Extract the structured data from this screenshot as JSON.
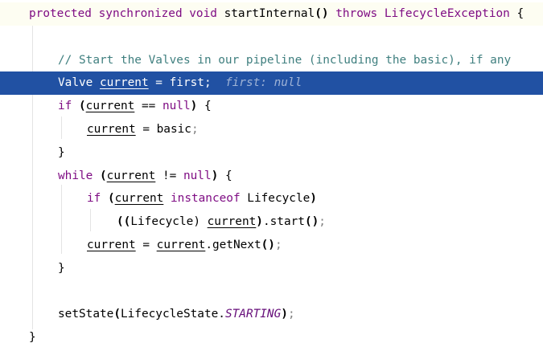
{
  "editor": {
    "lines": [
      {
        "tokens": [
          {
            "text": "protected synchronized void ",
            "role": "kw"
          },
          {
            "text": "startInternal",
            "role": "plain"
          },
          {
            "text": "()",
            "role": "paren"
          },
          {
            "text": " throws ",
            "role": "kw"
          },
          {
            "text": "LifecycleException",
            "role": "ty"
          },
          {
            "text": " {",
            "role": "plain"
          }
        ]
      },
      {
        "tokens": []
      },
      {
        "tokens": [
          {
            "text": "// Start the Valves in our pipeline (including the basic), if any",
            "role": "cm"
          }
        ]
      },
      {
        "tokens": [
          {
            "text": "Valve ",
            "role": "plain"
          },
          {
            "text": "current",
            "role": "var"
          },
          {
            "text": " = first;  ",
            "role": "plain"
          },
          {
            "text": "first: null",
            "role": "hint"
          }
        ]
      },
      {
        "tokens": [
          {
            "text": "if ",
            "role": "kw"
          },
          {
            "text": "(",
            "role": "paren"
          },
          {
            "text": "current",
            "role": "var"
          },
          {
            "text": " == ",
            "role": "plain"
          },
          {
            "text": "null",
            "role": "kw"
          },
          {
            "text": ")",
            "role": "paren"
          },
          {
            "text": " {",
            "role": "plain"
          }
        ]
      },
      {
        "tokens": [
          {
            "text": "current",
            "role": "var"
          },
          {
            "text": " = basic",
            "role": "plain"
          },
          {
            "text": ";",
            "role": "punct"
          }
        ]
      },
      {
        "tokens": [
          {
            "text": "}",
            "role": "plain"
          }
        ]
      },
      {
        "tokens": [
          {
            "text": "while ",
            "role": "kw"
          },
          {
            "text": "(",
            "role": "paren"
          },
          {
            "text": "current",
            "role": "var"
          },
          {
            "text": " != ",
            "role": "plain"
          },
          {
            "text": "null",
            "role": "kw"
          },
          {
            "text": ")",
            "role": "paren"
          },
          {
            "text": " {",
            "role": "plain"
          }
        ]
      },
      {
        "tokens": [
          {
            "text": "if ",
            "role": "kw"
          },
          {
            "text": "(",
            "role": "paren"
          },
          {
            "text": "current",
            "role": "var"
          },
          {
            "text": " instanceof ",
            "role": "kw"
          },
          {
            "text": "Lifecycle",
            "role": "plain"
          },
          {
            "text": ")",
            "role": "paren"
          }
        ]
      },
      {
        "tokens": [
          {
            "text": "((",
            "role": "paren"
          },
          {
            "text": "Lifecycle",
            "role": "plain"
          },
          {
            "text": ") ",
            "role": "plain"
          },
          {
            "text": "current",
            "role": "var"
          },
          {
            "text": ")",
            "role": "paren"
          },
          {
            "text": ".start",
            "role": "plain"
          },
          {
            "text": "()",
            "role": "paren"
          },
          {
            "text": ";",
            "role": "punct"
          }
        ]
      },
      {
        "tokens": [
          {
            "text": "current",
            "role": "var"
          },
          {
            "text": " = ",
            "role": "plain"
          },
          {
            "text": "current",
            "role": "var"
          },
          {
            "text": ".getNext",
            "role": "plain"
          },
          {
            "text": "()",
            "role": "paren"
          },
          {
            "text": ";",
            "role": "punct"
          }
        ]
      },
      {
        "tokens": [
          {
            "text": "}",
            "role": "plain"
          }
        ]
      },
      {
        "tokens": []
      },
      {
        "tokens": [
          {
            "text": "setState",
            "role": "plain"
          },
          {
            "text": "(",
            "role": "paren"
          },
          {
            "text": "LifecycleState.",
            "role": "plain"
          },
          {
            "text": "STARTING",
            "role": "const"
          },
          {
            "text": ")",
            "role": "paren"
          },
          {
            "text": ";",
            "role": "punct"
          }
        ]
      },
      {
        "tokens": [
          {
            "text": "}",
            "role": "plain"
          }
        ]
      }
    ],
    "colors": {
      "background": "#ffffff",
      "current_line": "#2151a3",
      "keyword": "#7f0d84",
      "comment": "#3f7f7f",
      "inline_hint": "#9fb3d6"
    }
  }
}
